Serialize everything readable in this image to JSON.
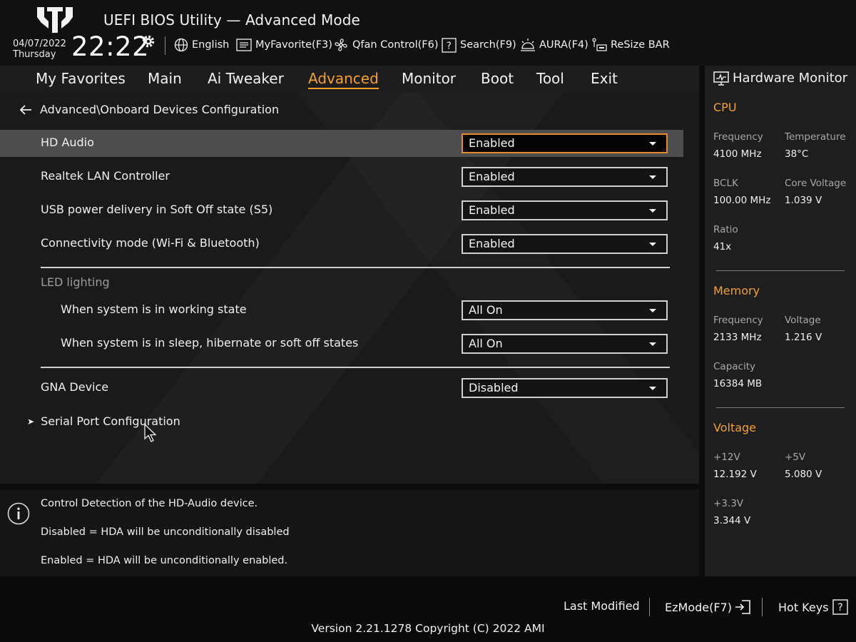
{
  "header": {
    "title": "UEFI BIOS Utility — Advanced Mode",
    "date": "04/07/2022",
    "day": "Thursday",
    "time": "22:22",
    "tools": {
      "language": "English",
      "favorite": "MyFavorite(F3)",
      "qfan": "Qfan Control(F6)",
      "search": "Search(F9)",
      "aura": "AURA(F4)",
      "resize": "ReSize BAR"
    }
  },
  "nav": {
    "tabs": [
      "My Favorites",
      "Main",
      "Ai Tweaker",
      "Advanced",
      "Monitor",
      "Boot",
      "Tool",
      "Exit"
    ],
    "active": "Advanced"
  },
  "breadcrumb": "Advanced\\Onboard Devices Configuration",
  "settings": {
    "hd_audio": {
      "label": "HD Audio",
      "value": "Enabled"
    },
    "lan": {
      "label": "Realtek LAN Controller",
      "value": "Enabled"
    },
    "usb_power": {
      "label": "USB power delivery in Soft Off state (S5)",
      "value": "Enabled"
    },
    "connectivity": {
      "label": "Connectivity mode (Wi-Fi & Bluetooth)",
      "value": "Enabled"
    },
    "led_section": "LED lighting",
    "led_working": {
      "label": "When system is in working state",
      "value": "All On"
    },
    "led_sleep": {
      "label": "When system is in sleep, hibernate or soft off states",
      "value": "All On"
    },
    "gna": {
      "label": "GNA Device",
      "value": "Disabled"
    },
    "serial_port": "Serial Port Configuration"
  },
  "help": {
    "line1": "Control Detection of the HD-Audio device.",
    "line2": "Disabled = HDA will be unconditionally disabled",
    "line3": "Enabled = HDA will be unconditionally enabled."
  },
  "hardware_monitor": {
    "title": "Hardware Monitor",
    "cpu": {
      "title": "CPU",
      "frequency_label": "Frequency",
      "frequency": "4100 MHz",
      "temperature_label": "Temperature",
      "temperature": "38°C",
      "bclk_label": "BCLK",
      "bclk": "100.00 MHz",
      "core_voltage_label": "Core Voltage",
      "core_voltage": "1.039 V",
      "ratio_label": "Ratio",
      "ratio": "41x"
    },
    "memory": {
      "title": "Memory",
      "frequency_label": "Frequency",
      "frequency": "2133 MHz",
      "voltage_label": "Voltage",
      "voltage": "1.216 V",
      "capacity_label": "Capacity",
      "capacity": "16384 MB"
    },
    "voltage": {
      "title": "Voltage",
      "v12_label": "+12V",
      "v12": "12.192 V",
      "v5_label": "+5V",
      "v5": "5.080 V",
      "v33_label": "+3.3V",
      "v33": "3.344 V"
    }
  },
  "footer": {
    "last_modified": "Last Modified",
    "ezmode": "EzMode(F7)",
    "hotkeys": "Hot Keys",
    "version": "Version 2.21.1278 Copyright (C) 2022 AMI"
  },
  "colors": {
    "accent": "#f5a030",
    "focus_border": "#e68a2e"
  }
}
